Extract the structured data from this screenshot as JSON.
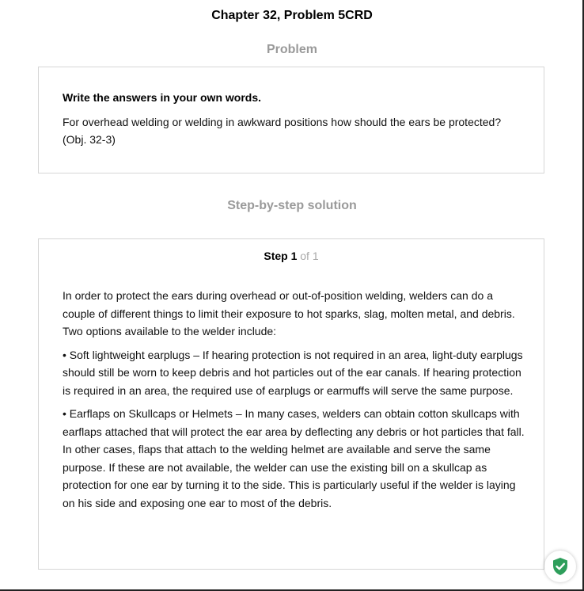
{
  "header": {
    "title": "Chapter 32, Problem 5CRD"
  },
  "problem": {
    "section_label": "Problem",
    "heading": "Write the answers in your own words.",
    "text": "For overhead welding or welding in awkward positions how should the ears be protected? (Obj. 32-3)"
  },
  "solution": {
    "section_label": "Step-by-step solution",
    "step_word": "Step 1",
    "step_of": " of 1",
    "paragraphs": [
      "In order to protect the ears during overhead or out-of-position welding, welders can do a couple of different things to limit their exposure to hot sparks, slag, molten metal, and debris. Two options available to the welder include:",
      "• Soft lightweight earplugs – If hearing protection is not required in an area, light-duty earplugs should still be worn to keep debris and hot particles out of the ear canals. If hearing protection is required in an area, the required use of earplugs or earmuffs will serve the same purpose.",
      "• Earflaps on Skullcaps or Helmets – In many cases, welders can obtain cotton skullcaps with earflaps attached that will protect the ear area by deflecting any debris or hot particles that fall. In other cases, flaps that attach to the welding helmet are available and serve the same purpose. If these are not available, the welder can use the existing bill on a skullcap as protection for one ear by turning it to the side. This is particularly useful if the welder is laying on his side and exposing one ear to most of the debris."
    ]
  },
  "widget": {
    "icon": "shield-check-icon",
    "color": "#2e9e5b"
  }
}
